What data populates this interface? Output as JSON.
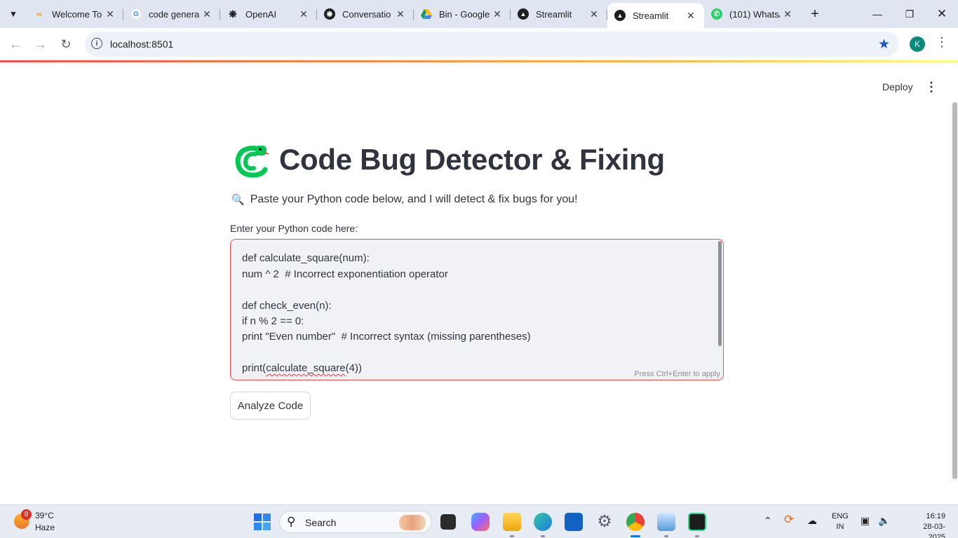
{
  "browser": {
    "tabs": [
      {
        "title": "Welcome To",
        "icon": "colab-icon",
        "active": false
      },
      {
        "title": "code genera",
        "icon": "google-icon",
        "active": false
      },
      {
        "title": "OpenAI",
        "icon": "openai-icon",
        "active": false
      },
      {
        "title": "Conversatio",
        "icon": "chatgpt-icon",
        "active": false
      },
      {
        "title": "Bin - Google",
        "icon": "google-drive-icon",
        "active": false
      },
      {
        "title": "Streamlit",
        "icon": "streamlit-icon",
        "active": false
      },
      {
        "title": "Streamlit",
        "icon": "streamlit-icon",
        "active": true
      },
      {
        "title": "(101) Whats/",
        "icon": "whatsapp-icon",
        "active": false
      }
    ],
    "url": "localhost:8501",
    "profile_initial": "K"
  },
  "streamlit": {
    "deploy_label": "Deploy"
  },
  "app": {
    "title": "Code Bug Detector & Fixing",
    "subtitle": "Paste your Python code below, and I will detect & fix bugs for you!",
    "code_label": "Enter your Python code here:",
    "code_lines": [
      "def calculate_square(num):",
      "num ^ 2  # Incorrect exponentiation operator",
      "",
      "def check_even(n):",
      "if n % 2 == 0:",
      "print \"Even number\"  # Incorrect syntax (missing parentheses)",
      "",
      "print(calculate_square(4))"
    ],
    "last_line_parts": {
      "pre": "print(",
      "underlined": "calculate_square",
      "post": "(4))"
    },
    "hint": "Press Ctrl+Enter to apply",
    "analyze_label": "Analyze Code",
    "accent_color": "#ff4b4b"
  },
  "taskbar": {
    "weather_badge": "8",
    "temperature": "39°C",
    "condition": "Haze",
    "search_label": "Search",
    "language": "ENG",
    "region": "IN",
    "time": "16:19",
    "date": "28-03-2025"
  }
}
